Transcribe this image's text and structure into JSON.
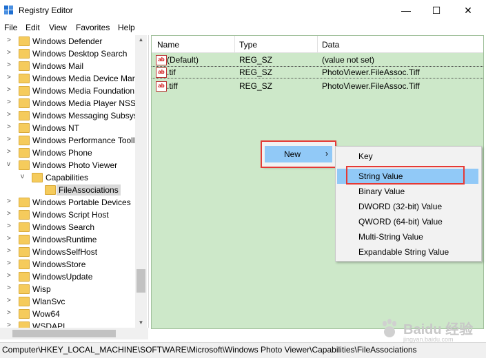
{
  "window": {
    "title": "Registry Editor",
    "minimize_glyph": "—",
    "maximize_glyph": "☐",
    "close_glyph": "✕"
  },
  "menu": [
    "File",
    "Edit",
    "View",
    "Favorites",
    "Help"
  ],
  "tree": [
    {
      "label": "Windows Defender",
      "arrow": ">"
    },
    {
      "label": "Windows Desktop Search",
      "arrow": ">"
    },
    {
      "label": "Windows Mail",
      "arrow": ">"
    },
    {
      "label": "Windows Media Device Mar",
      "arrow": ">"
    },
    {
      "label": "Windows Media Foundation",
      "arrow": ">"
    },
    {
      "label": "Windows Media Player NSS",
      "arrow": ">"
    },
    {
      "label": "Windows Messaging Subsys",
      "arrow": ">"
    },
    {
      "label": "Windows NT",
      "arrow": ">"
    },
    {
      "label": "Windows Performance Tooll",
      "arrow": ">"
    },
    {
      "label": "Windows Phone",
      "arrow": ">"
    },
    {
      "label": "Windows Photo Viewer",
      "arrow": "v"
    },
    {
      "label": "Capabilities",
      "arrow": "v"
    },
    {
      "label": "FileAssociations",
      "arrow": "",
      "selected": true
    },
    {
      "label": "Windows Portable Devices",
      "arrow": ">"
    },
    {
      "label": "Windows Script Host",
      "arrow": ">"
    },
    {
      "label": "Windows Search",
      "arrow": ">"
    },
    {
      "label": "WindowsRuntime",
      "arrow": ">"
    },
    {
      "label": "WindowsSelfHost",
      "arrow": ">"
    },
    {
      "label": "WindowsStore",
      "arrow": ">"
    },
    {
      "label": "WindowsUpdate",
      "arrow": ">"
    },
    {
      "label": "Wisp",
      "arrow": ">"
    },
    {
      "label": "WlanSvc",
      "arrow": ">"
    },
    {
      "label": "Wow64",
      "arrow": ">"
    },
    {
      "label": "WSDAPI",
      "arrow": ">"
    }
  ],
  "columns": {
    "name": "Name",
    "type": "Type",
    "data": "Data"
  },
  "values": [
    {
      "name": "(Default)",
      "type": "REG_SZ",
      "data": "(value not set)",
      "icon_text": "ab"
    },
    {
      "name": ".tif",
      "type": "REG_SZ",
      "data": "PhotoViewer.FileAssoc.Tiff",
      "icon_text": "ab"
    },
    {
      "name": ".tiff",
      "type": "REG_SZ",
      "data": "PhotoViewer.FileAssoc.Tiff",
      "icon_text": "ab"
    }
  ],
  "context_menu": {
    "new_label": "New",
    "chevron": "›"
  },
  "submenu": [
    "Key",
    "String Value",
    "Binary Value",
    "DWORD (32-bit) Value",
    "QWORD (64-bit) Value",
    "Multi-String Value",
    "Expandable String Value"
  ],
  "status": "Computer\\HKEY_LOCAL_MACHINE\\SOFTWARE\\Microsoft\\Windows Photo Viewer\\Capabilities\\FileAssociations",
  "watermark": {
    "text": "Baidu 经验",
    "sub": "jingyan.baidu.com"
  },
  "colors": {
    "list_bg": "#cde8c9",
    "highlight": "#91c9f7",
    "callout": "#e53935"
  }
}
